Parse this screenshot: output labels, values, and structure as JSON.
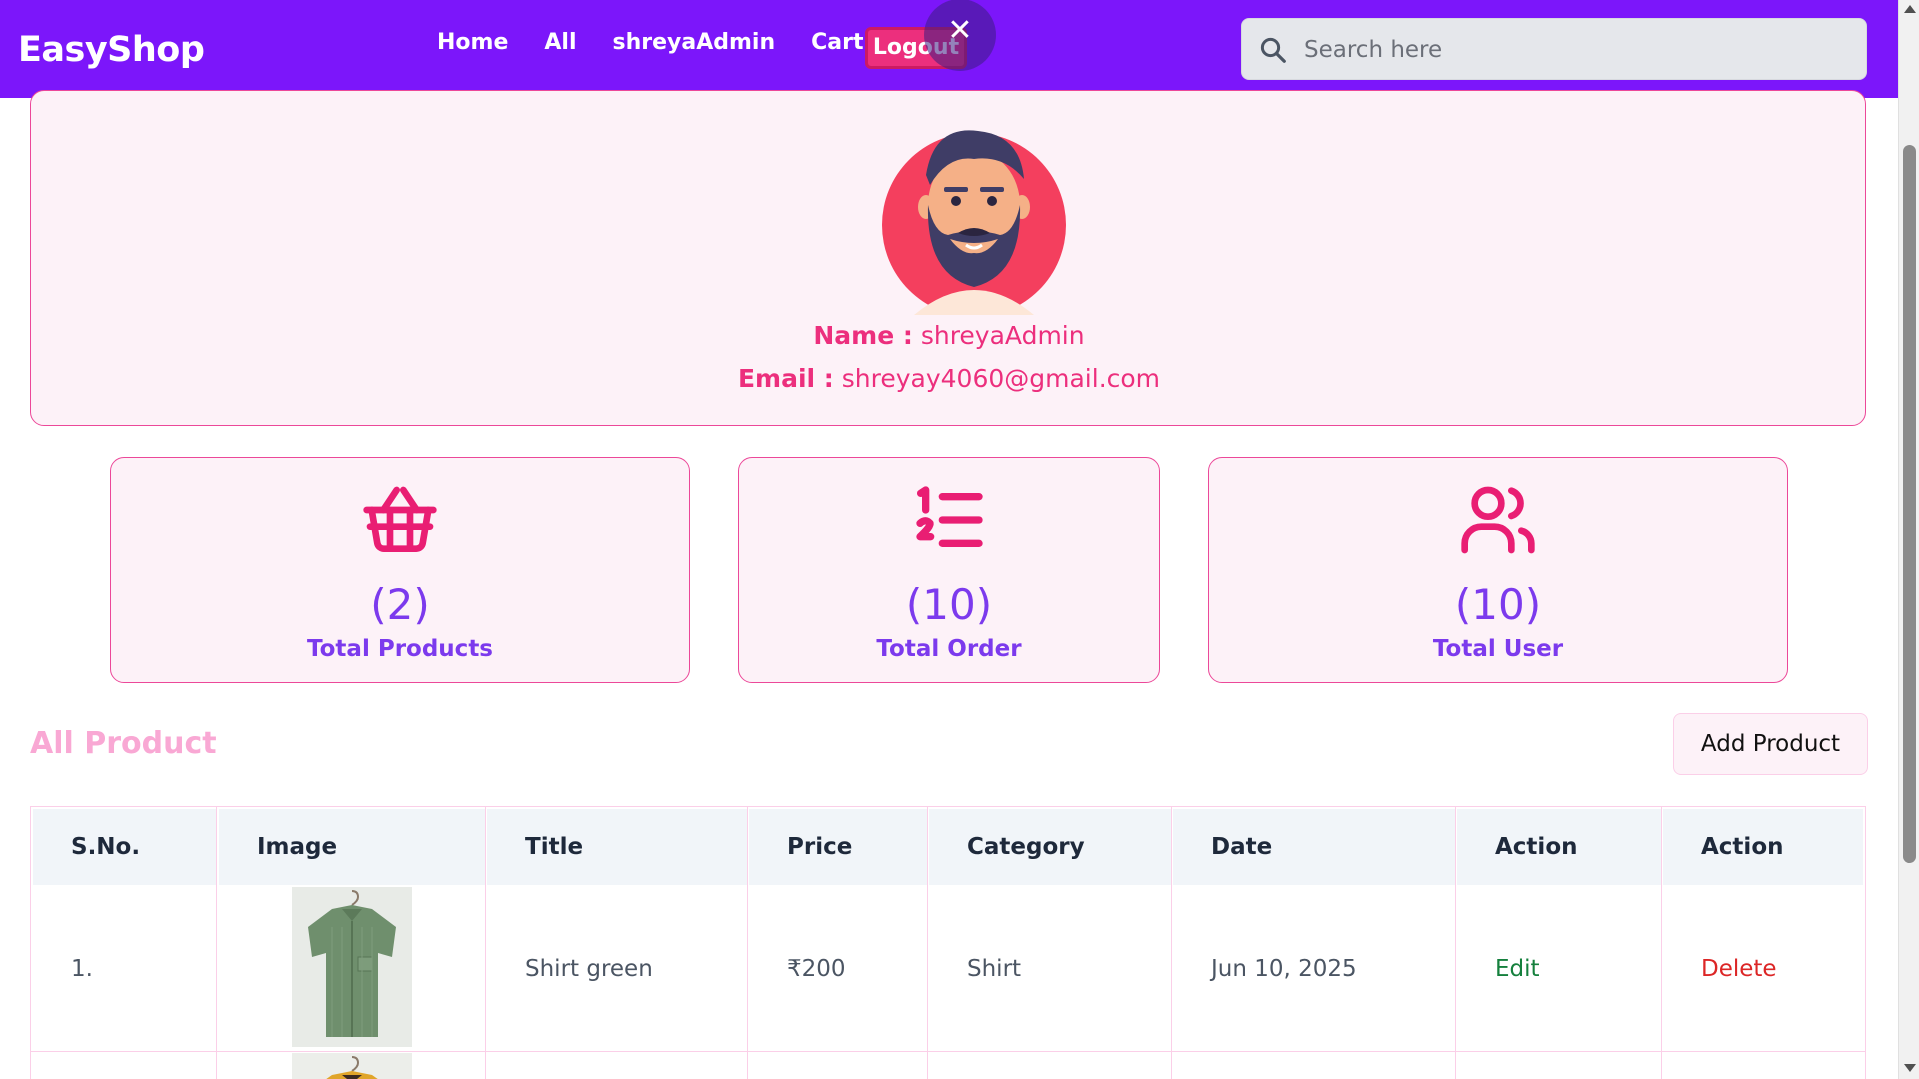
{
  "brand": "EasyShop",
  "nav": {
    "links": [
      "Home",
      "All",
      "shreyaAdmin",
      "Cart"
    ],
    "logout_label": "Logout",
    "close_glyph": "✕"
  },
  "search": {
    "placeholder": "Search here",
    "value": ""
  },
  "profile": {
    "name_label": "Name :",
    "name_value": "shreyaAdmin",
    "email_label": "Email :",
    "email_value": "shreyay4060@gmail.com"
  },
  "stats": [
    {
      "icon": "basket-icon",
      "count": "(2)",
      "label": "Total Products"
    },
    {
      "icon": "list-ordered-icon",
      "count": "(10)",
      "label": "Total Order"
    },
    {
      "icon": "users-icon",
      "count": "(10)",
      "label": "Total User"
    }
  ],
  "products": {
    "title": "All Product",
    "add_button": "Add Product",
    "columns": [
      "S.No.",
      "Image",
      "Title",
      "Price",
      "Category",
      "Date",
      "Action",
      "Action"
    ],
    "rows": [
      {
        "sno": "1.",
        "image": "green-shirt-image",
        "title": "Shirt green",
        "price": "₹200",
        "category": "Shirt",
        "date": "Jun 10, 2025",
        "edit": "Edit",
        "delete": "Delete"
      }
    ]
  },
  "colors": {
    "navbar": "#7c16fa",
    "accent_pink": "#ec2f7d",
    "stat_purple": "#7c3aed",
    "card_bg": "#fdf2f8",
    "edit_green": "#15803d",
    "delete_red": "#dc2626"
  }
}
